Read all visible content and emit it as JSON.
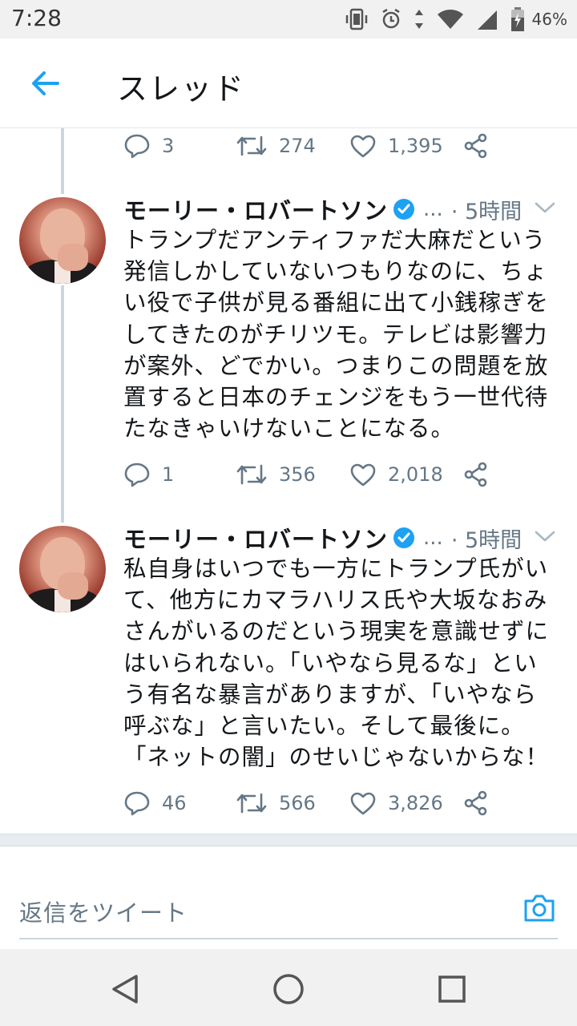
{
  "status": {
    "time": "7:28",
    "battery": "46%"
  },
  "header": {
    "title": "スレッド"
  },
  "colors": {
    "accent": "#1da1f2",
    "secondary_text": "#657786",
    "primary_text": "#14171a"
  },
  "thread": {
    "top_actions": {
      "replies": "3",
      "retweets": "274",
      "likes": "1,395"
    },
    "tweets": [
      {
        "author": "モーリー・ロバートソン",
        "handle": "...",
        "time": "· 5時間",
        "lines": [
          "トランプだアンティファだ大麻だという",
          "発信しかしていないつもりなのに、ちょ",
          "い役で子供が見る番組に出て小銭稼ぎを",
          "してきたのがチリツモ。テレビは影響力",
          "が案外、どでかい。つまりこの問題を放",
          "置すると日本のチェンジをもう一世代待",
          "たなきゃいけないことになる。"
        ],
        "replies": "1",
        "retweets": "356",
        "likes": "2,018"
      },
      {
        "author": "モーリー・ロバートソン",
        "handle": "...",
        "time": "· 5時間",
        "lines": [
          "私自身はいつでも一方にトランプ氏がい",
          "て、他方にカマラハリス氏や大坂なおみ",
          "さんがいるのだという現実を意識せずに",
          "はいられない。「いやなら見るな」とい",
          "う有名な暴言がありますが、「いやなら",
          "呼ぶな」と言いたい。そして最後に。",
          "「ネットの闇」のせいじゃないからな！"
        ],
        "replies": "46",
        "retweets": "566",
        "likes": "3,826"
      }
    ]
  },
  "reply_bar": {
    "placeholder": "返信をツイート"
  },
  "icons": [
    "back-arrow-icon",
    "reply-icon",
    "retweet-icon",
    "like-icon",
    "share-icon",
    "verified-icon",
    "caret-down-icon",
    "camera-icon",
    "nav-back-icon",
    "nav-home-icon",
    "nav-recents-icon"
  ]
}
